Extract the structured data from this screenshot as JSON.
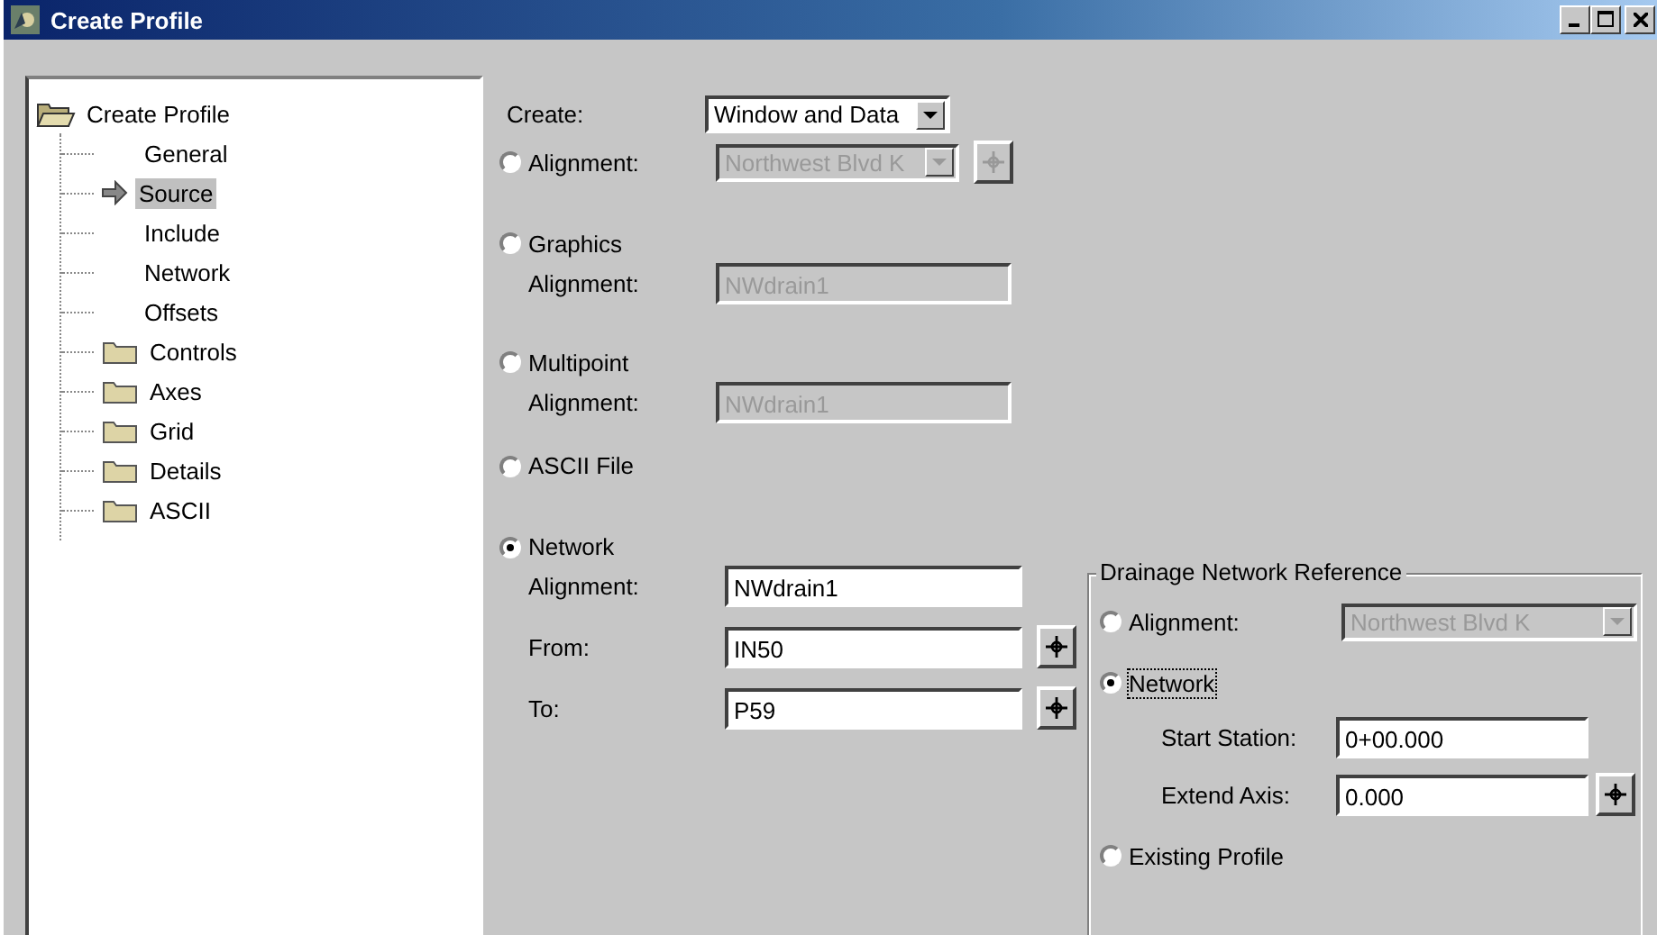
{
  "window": {
    "title": "Create Profile"
  },
  "tree": [
    {
      "label": "Create Profile",
      "kind": "folder-open",
      "selected": false,
      "children": [
        {
          "label": "General",
          "kind": "page",
          "selected": false
        },
        {
          "label": "Source",
          "kind": "page",
          "selected": true
        },
        {
          "label": "Include",
          "kind": "page",
          "selected": false
        },
        {
          "label": "Network",
          "kind": "page",
          "selected": false
        },
        {
          "label": "Offsets",
          "kind": "page",
          "selected": false
        },
        {
          "label": "Controls",
          "kind": "folder",
          "selected": false
        },
        {
          "label": "Axes",
          "kind": "folder",
          "selected": false
        },
        {
          "label": "Grid",
          "kind": "folder",
          "selected": false
        },
        {
          "label": "Details",
          "kind": "folder",
          "selected": false
        },
        {
          "label": "ASCII",
          "kind": "folder",
          "selected": false
        }
      ]
    }
  ],
  "create": {
    "label": "Create:",
    "value": "Window and Data"
  },
  "sources": [
    {
      "kind": "combo",
      "label": "Alignment:",
      "value": "Northwest Blvd K",
      "selected": false,
      "disabled": true,
      "pick": true
    },
    {
      "kind": "field",
      "label": "Graphics",
      "field_label": "Alignment:",
      "value": "NWdrain1",
      "selected": false,
      "disabled": true
    },
    {
      "kind": "field",
      "label": "Multipoint",
      "field_label": "Alignment:",
      "value": "NWdrain1",
      "selected": false,
      "disabled": true
    },
    {
      "kind": "plain",
      "label": "ASCII File",
      "selected": false
    },
    {
      "kind": "network",
      "label": "Network",
      "selected": true,
      "fields": [
        {
          "label": "Alignment:",
          "value": "NWdrain1",
          "pick": false
        },
        {
          "label": "From:",
          "value": "IN50",
          "pick": true
        },
        {
          "label": "To:",
          "value": "P59",
          "pick": true
        }
      ]
    }
  ],
  "group": {
    "title": "Drainage Network Reference",
    "options": [
      {
        "kind": "combo",
        "label": "Alignment:",
        "value": "Northwest Blvd K",
        "disabled": true,
        "selected": false,
        "focused": false
      },
      {
        "kind": "fields",
        "label": "Network",
        "selected": true,
        "focused": true,
        "fields": [
          {
            "label": "Start Station:",
            "value": "0+00.000",
            "pick": false
          },
          {
            "label": "Extend Axis:",
            "value": "0.000",
            "pick": true
          }
        ]
      },
      {
        "kind": "plain",
        "label": "Existing Profile",
        "selected": false,
        "focused": false
      }
    ]
  }
}
